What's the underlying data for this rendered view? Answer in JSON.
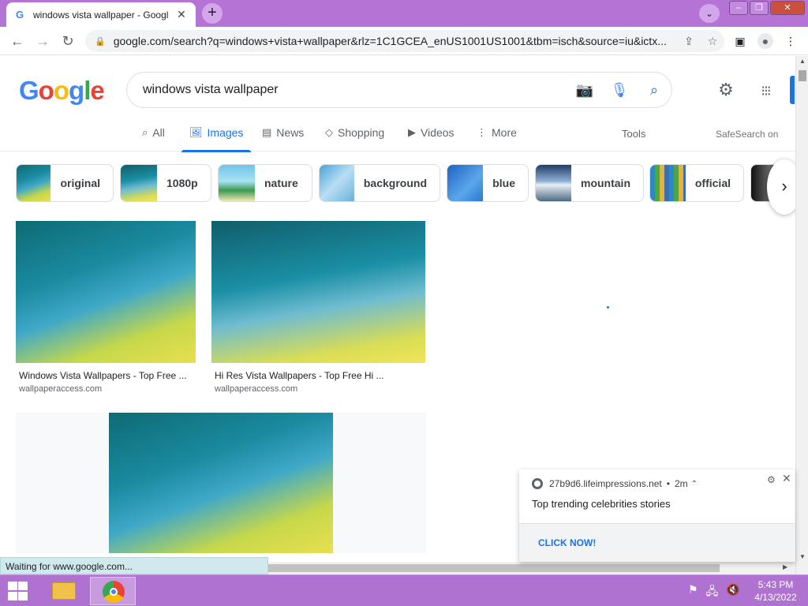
{
  "browser": {
    "tab_title": "windows vista wallpaper - Googl",
    "url": "google.com/search?q=windows+vista+wallpaper&rlz=1C1GCEA_enUS1001US1001&tbm=isch&source=iu&ictx...",
    "new_tab_label": "+",
    "status_text": "Waiting for www.google.com..."
  },
  "search": {
    "logo": [
      "G",
      "o",
      "o",
      "g",
      "l",
      "e"
    ],
    "logo_colors": [
      "#4285f4",
      "#ea4335",
      "#fbbc05",
      "#4285f4",
      "#34a853",
      "#ea4335"
    ],
    "query": "windows vista wallpaper"
  },
  "nav": {
    "tabs": [
      {
        "label": "All",
        "icon": "search-icon"
      },
      {
        "label": "Images",
        "icon": "image-icon",
        "active": true
      },
      {
        "label": "News",
        "icon": "news-icon"
      },
      {
        "label": "Shopping",
        "icon": "tag-icon"
      },
      {
        "label": "Videos",
        "icon": "play-icon"
      },
      {
        "label": "More",
        "icon": "more-vert-icon"
      }
    ],
    "tools": "Tools",
    "safesearch": "SafeSearch on"
  },
  "chips": [
    {
      "label": "original"
    },
    {
      "label": "1080p"
    },
    {
      "label": "nature"
    },
    {
      "label": "background"
    },
    {
      "label": "blue"
    },
    {
      "label": "mountain"
    },
    {
      "label": "official"
    }
  ],
  "results": [
    {
      "title": "Windows Vista Wallpapers - Top Free ...",
      "source": "wallpaperaccess.com"
    },
    {
      "title": "Hi Res Vista Wallpapers - Top Free Hi ...",
      "source": "wallpaperaccess.com"
    }
  ],
  "notification": {
    "source": "27b9d6.lifeimpressions.net",
    "time": "2m",
    "message": "Top trending celebrities stories",
    "action": "CLICK NOW!"
  },
  "taskbar": {
    "time": "5:43 PM",
    "date": "4/13/2022"
  },
  "colors": {
    "accent": "#1a73e8",
    "titlebar": "#b573d6",
    "taskbar": "#b072d0"
  }
}
